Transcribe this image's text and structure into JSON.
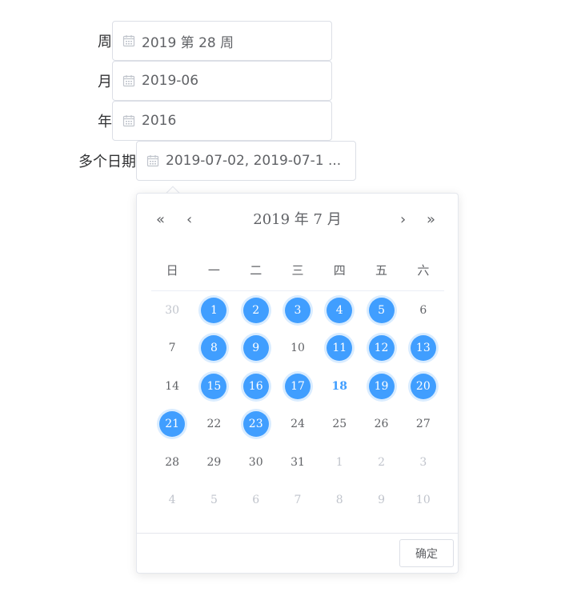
{
  "form": {
    "week_label": "周",
    "week_value": "2019 第 28 周",
    "month_label": "月",
    "month_value": "2019-06",
    "year_label": "年",
    "year_value": "2016",
    "dates_label": "多个日期",
    "dates_value": "2019-07-02, 2019-07-1 ..."
  },
  "icons": {
    "calendar": "calendar-icon",
    "prev_year": "double-chevron-left-icon",
    "prev_month": "chevron-left-icon",
    "next_month": "chevron-right-icon",
    "next_year": "double-chevron-right-icon"
  },
  "picker": {
    "prev_year": "«",
    "prev_month": "‹",
    "next_month": "›",
    "next_year": "»",
    "title": "2019 年  7 月",
    "weekdays": [
      "日",
      "一",
      "二",
      "三",
      "四",
      "五",
      "六"
    ],
    "weeks": [
      [
        {
          "d": "30",
          "t": "other"
        },
        {
          "d": "1",
          "t": "selected"
        },
        {
          "d": "2",
          "t": "selected"
        },
        {
          "d": "3",
          "t": "selected"
        },
        {
          "d": "4",
          "t": "selected"
        },
        {
          "d": "5",
          "t": "selected"
        },
        {
          "d": "6",
          "t": "normal"
        }
      ],
      [
        {
          "d": "7",
          "t": "normal"
        },
        {
          "d": "8",
          "t": "selected"
        },
        {
          "d": "9",
          "t": "selected"
        },
        {
          "d": "10",
          "t": "normal"
        },
        {
          "d": "11",
          "t": "selected"
        },
        {
          "d": "12",
          "t": "selected"
        },
        {
          "d": "13",
          "t": "selected"
        }
      ],
      [
        {
          "d": "14",
          "t": "normal"
        },
        {
          "d": "15",
          "t": "selected"
        },
        {
          "d": "16",
          "t": "selected"
        },
        {
          "d": "17",
          "t": "selected"
        },
        {
          "d": "18",
          "t": "today"
        },
        {
          "d": "19",
          "t": "selected"
        },
        {
          "d": "20",
          "t": "selected"
        }
      ],
      [
        {
          "d": "21",
          "t": "selected"
        },
        {
          "d": "22",
          "t": "normal"
        },
        {
          "d": "23",
          "t": "selected"
        },
        {
          "d": "24",
          "t": "normal"
        },
        {
          "d": "25",
          "t": "normal"
        },
        {
          "d": "26",
          "t": "normal"
        },
        {
          "d": "27",
          "t": "normal"
        }
      ],
      [
        {
          "d": "28",
          "t": "normal"
        },
        {
          "d": "29",
          "t": "normal"
        },
        {
          "d": "30",
          "t": "normal"
        },
        {
          "d": "31",
          "t": "normal"
        },
        {
          "d": "1",
          "t": "other"
        },
        {
          "d": "2",
          "t": "other"
        },
        {
          "d": "3",
          "t": "other"
        }
      ],
      [
        {
          "d": "4",
          "t": "other"
        },
        {
          "d": "5",
          "t": "other"
        },
        {
          "d": "6",
          "t": "other"
        },
        {
          "d": "7",
          "t": "other"
        },
        {
          "d": "8",
          "t": "other"
        },
        {
          "d": "9",
          "t": "other"
        },
        {
          "d": "10",
          "t": "other"
        }
      ]
    ],
    "confirm_label": "确定"
  },
  "colors": {
    "accent": "#409eff",
    "selected_ring": "#d9ecff",
    "muted": "#c0c4cc",
    "text": "#606266",
    "border": "#dcdfe6"
  }
}
